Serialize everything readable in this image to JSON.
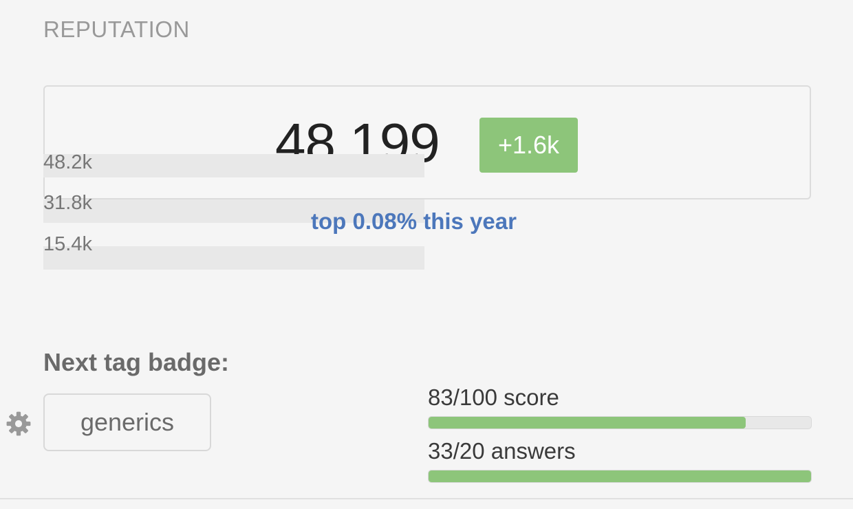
{
  "reputation": {
    "title": "REPUTATION",
    "value": "48,199",
    "change": "+1.6k",
    "rank": "top 0.08% this year",
    "graph_labels": [
      "48.2k",
      "31.8k",
      "15.4k"
    ]
  },
  "next_badge": {
    "label": "Next tag badge:",
    "tag": "generics",
    "score_label": "83/100 score",
    "score_progress": 0.83,
    "answers_label": "33/20 answers",
    "answers_progress": 1.0
  },
  "colors": {
    "accent_green": "#8dc57a",
    "link_blue": "#4c77bb"
  },
  "icons": {
    "settings": "gear-icon"
  }
}
